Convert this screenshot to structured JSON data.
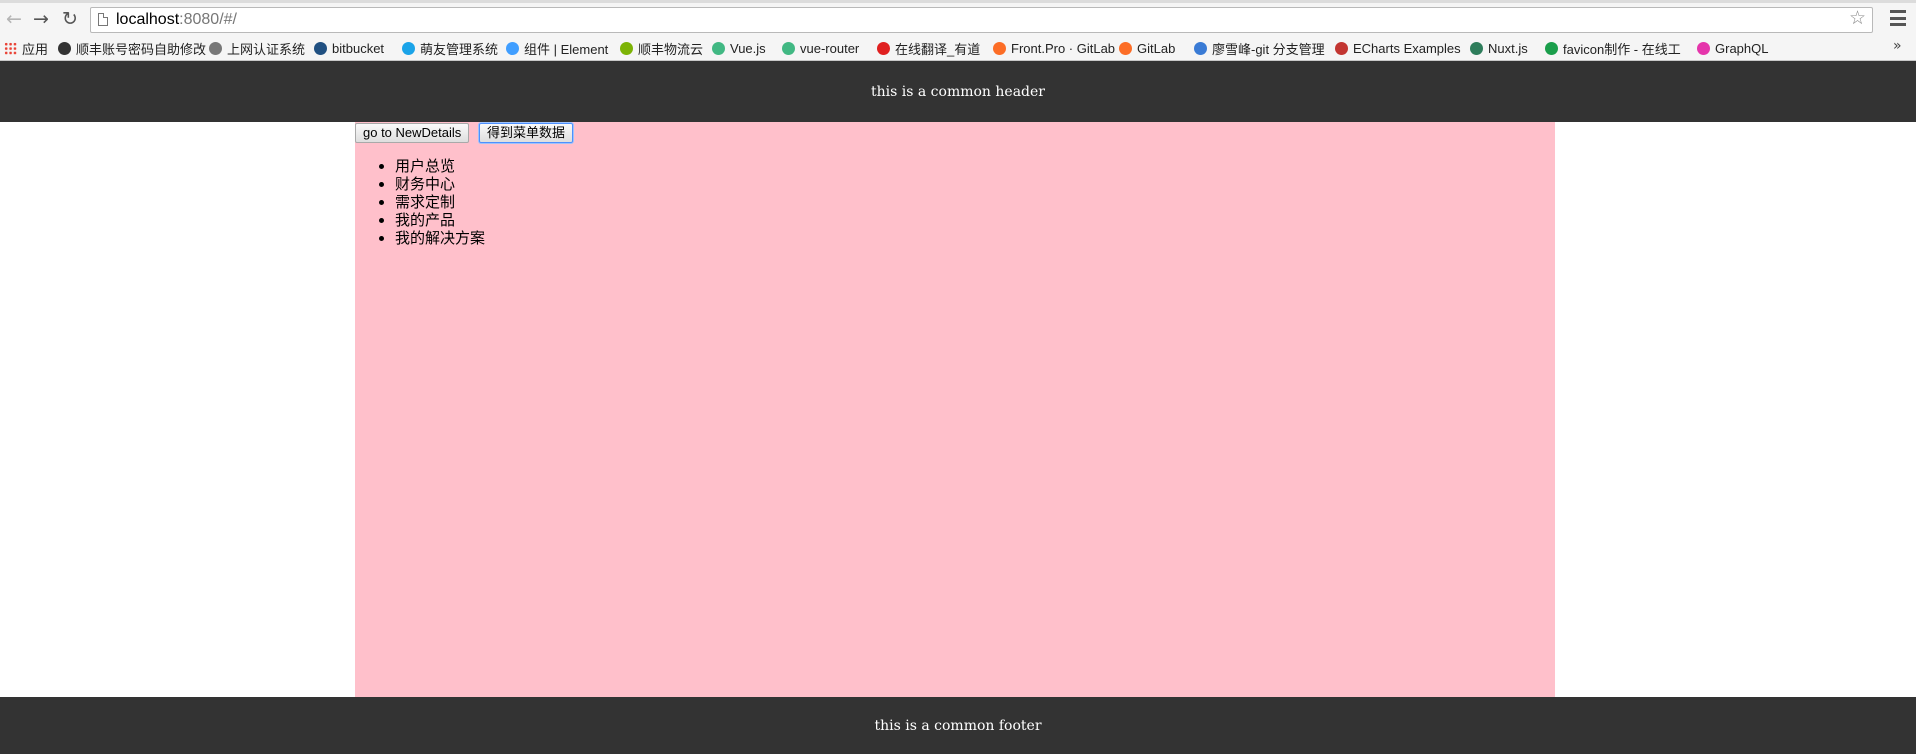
{
  "browser": {
    "url_host": "localhost",
    "url_path": ":8080/#/",
    "back_icon": "arrow-left-icon",
    "forward_icon": "arrow-right-icon",
    "reload_icon": "reload-icon",
    "star_icon": "star-icon",
    "menu_icon": "hamburger-menu-icon",
    "overflow_glyph": "»"
  },
  "bookmarks": [
    {
      "label": "应用",
      "icon": "apps-grid-icon",
      "color": "#e94235"
    },
    {
      "label": "顺丰账号密码自助修改",
      "icon": "sf-logo-icon",
      "color": "#333333"
    },
    {
      "label": "上网认证系统",
      "icon": "page-icon",
      "color": "#777777"
    },
    {
      "label": "bitbucket",
      "icon": "bitbucket-icon",
      "color": "#205081"
    },
    {
      "label": "萌友管理系统",
      "icon": "mengyou-icon",
      "color": "#1aa3e8"
    },
    {
      "label": "组件 | Element",
      "icon": "element-icon",
      "color": "#409eff"
    },
    {
      "label": "顺丰物流云",
      "icon": "sf-cloud-icon",
      "color": "#7cb305"
    },
    {
      "label": "Vue.js",
      "icon": "vue-icon",
      "color": "#41b883"
    },
    {
      "label": "vue-router",
      "icon": "vue-icon",
      "color": "#41b883"
    },
    {
      "label": "在线翻译_有道",
      "icon": "youdao-icon",
      "color": "#e02020"
    },
    {
      "label": "Front.Pro · GitLab",
      "icon": "gitlab-icon",
      "color": "#fc6d26"
    },
    {
      "label": "GitLab",
      "icon": "gitlab-icon",
      "color": "#fc6d26"
    },
    {
      "label": "廖雪峰-git 分支管理",
      "icon": "rocket-icon",
      "color": "#3a7bd5"
    },
    {
      "label": "ECharts Examples",
      "icon": "echarts-icon",
      "color": "#c23531"
    },
    {
      "label": "Nuxt.js",
      "icon": "nuxt-icon",
      "color": "#2e7d5b"
    },
    {
      "label": "favicon制作 - 在线工",
      "icon": "favicon-tool-icon",
      "color": "#1a9e4b"
    },
    {
      "label": "GraphQL",
      "icon": "graphql-icon",
      "color": "#e535ab"
    }
  ],
  "header": {
    "text": "this is a common header"
  },
  "toolbar": {
    "go_details_label": "go to NewDetails",
    "get_menu_label": "得到菜单数据"
  },
  "menu": {
    "items": [
      "用户总览",
      "财务中心",
      "需求定制",
      "我的产品",
      "我的解决方案"
    ]
  },
  "footer": {
    "text": "this is a common footer"
  },
  "colors": {
    "header_bg": "#333333",
    "footer_bg": "#333333",
    "main_bg": "#ffc0cb",
    "text_light": "#ffffff"
  }
}
